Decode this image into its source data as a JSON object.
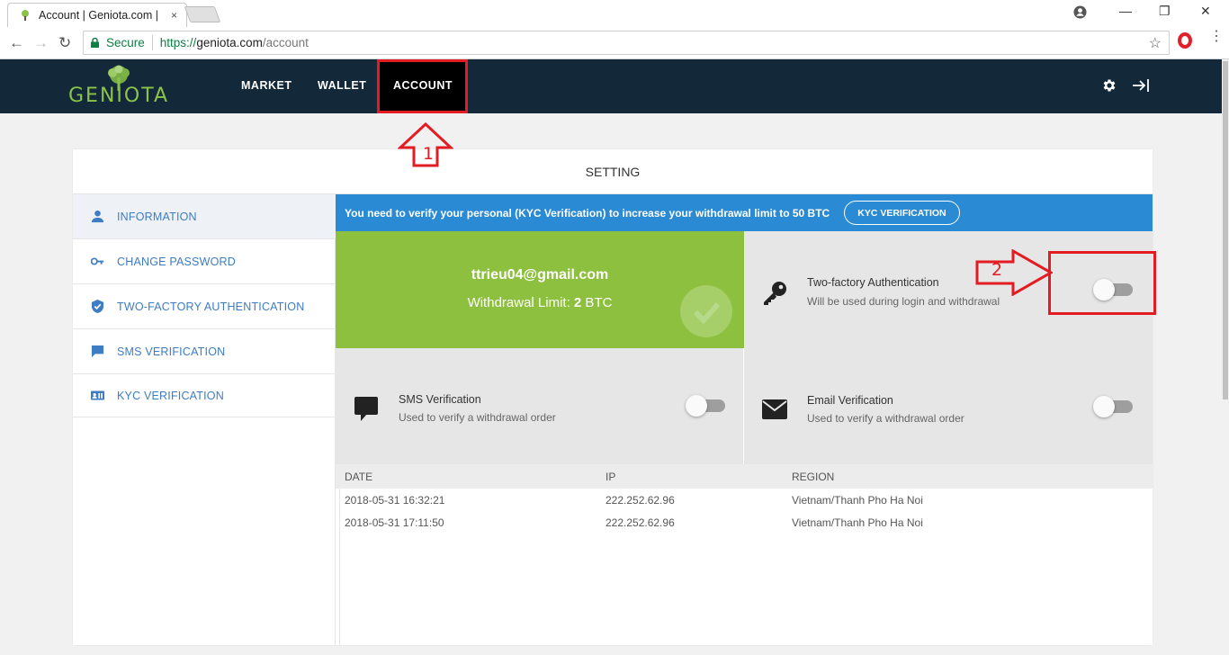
{
  "browser": {
    "tab_title": "Account | Geniota.com |",
    "tab_close": "×",
    "secure_label": "Secure",
    "url_scheme": "https://",
    "url_host": "geniota.com",
    "url_path": "/account",
    "win_minimize": "—",
    "win_restore": "❐",
    "win_close": "✕",
    "back": "←",
    "forward": "→",
    "reload": "↻",
    "bookmark": "☆",
    "menu": "⋮"
  },
  "header": {
    "logo_text": "GENIOTA",
    "nav": [
      "MARKET",
      "WALLET",
      "ACCOUNT"
    ],
    "active_nav": "ACCOUNT",
    "brand_color": "#8bc34a",
    "bg_color": "#13293a"
  },
  "card": {
    "title": "SETTING"
  },
  "sidebar": {
    "items": [
      {
        "label": "INFORMATION",
        "icon": "user-icon"
      },
      {
        "label": "CHANGE PASSWORD",
        "icon": "key-icon"
      },
      {
        "label": "TWO-FACTORY AUTHENTICATION",
        "icon": "shield-check-icon"
      },
      {
        "label": "SMS VERIFICATION",
        "icon": "message-icon"
      },
      {
        "label": "KYC VERIFICATION",
        "icon": "id-card-icon"
      }
    ],
    "active": "INFORMATION"
  },
  "kyc_banner": {
    "text": "You need to verify your personal (KYC Verification) to increase your withdrawal limit to 50 BTC",
    "button": "KYC VERIFICATION"
  },
  "account": {
    "email": "ttrieu04@gmail.com",
    "limit_prefix": "Withdrawal Limit: ",
    "limit_value": "2",
    "limit_unit": " BTC"
  },
  "settings": {
    "two_factor": {
      "title": "Two-factory Authentication",
      "subtitle": "Will be used during login and withdrawal",
      "enabled": false
    },
    "sms": {
      "title": "SMS Verification",
      "subtitle": "Used to verify a withdrawal order",
      "enabled": false
    },
    "email": {
      "title": "Email Verification",
      "subtitle": "Used to verify a withdrawal order",
      "enabled": false
    }
  },
  "login_log": {
    "columns": [
      "DATE",
      "IP",
      "REGION"
    ],
    "rows": [
      [
        "2018-05-31 16:32:21",
        "222.252.62.96",
        "Vietnam/Thanh Pho Ha Noi"
      ],
      [
        "2018-05-31 17:11:50",
        "222.252.62.96",
        "Vietnam/Thanh Pho Ha Noi"
      ]
    ]
  },
  "annotations": {
    "step1": "1",
    "step2": "2",
    "color": "#e31c23"
  }
}
